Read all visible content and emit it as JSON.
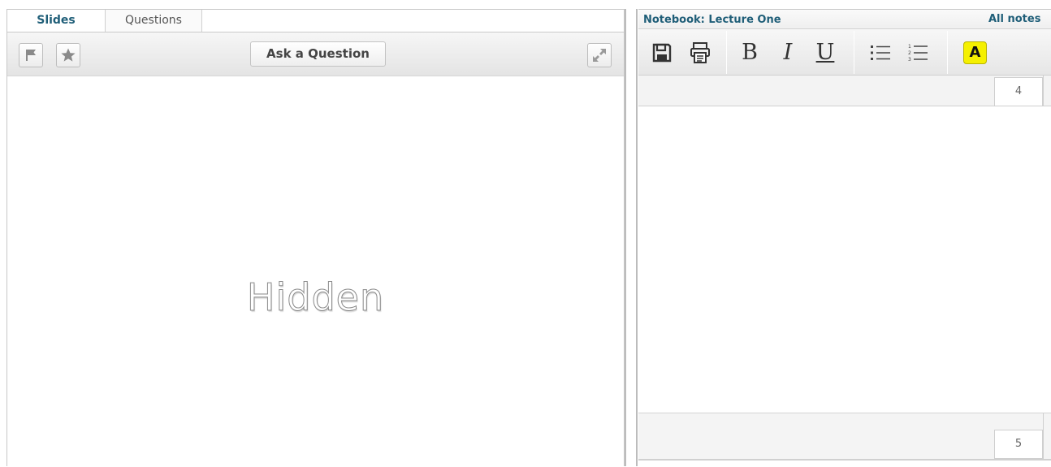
{
  "left_panel": {
    "tabs": [
      {
        "label": "Slides",
        "active": true
      },
      {
        "label": "Questions",
        "active": false
      }
    ],
    "toolbar": {
      "flag_icon": "flag-icon",
      "star_icon": "star-icon",
      "ask_button_label": "Ask a Question",
      "expand_icon": "expand-icon"
    },
    "slide": {
      "status_text": "Hidden"
    }
  },
  "right_panel": {
    "notebook_title": "Notebook: Lecture One",
    "all_notes_label": "All notes",
    "toolbar": {
      "save_icon": "save-icon",
      "print_icon": "print-icon",
      "bold_label": "B",
      "italic_label": "I",
      "underline_label": "U",
      "bullet_list_icon": "bullet-list-icon",
      "numbered_list_icon": "numbered-list-icon",
      "highlight_label": "A",
      "highlight_color": "#f5f000"
    },
    "pages": [
      {
        "number": "4"
      },
      {
        "number": "5"
      }
    ]
  },
  "colors": {
    "accent": "#1f5e78",
    "toolbar_bg": "#ececec"
  }
}
